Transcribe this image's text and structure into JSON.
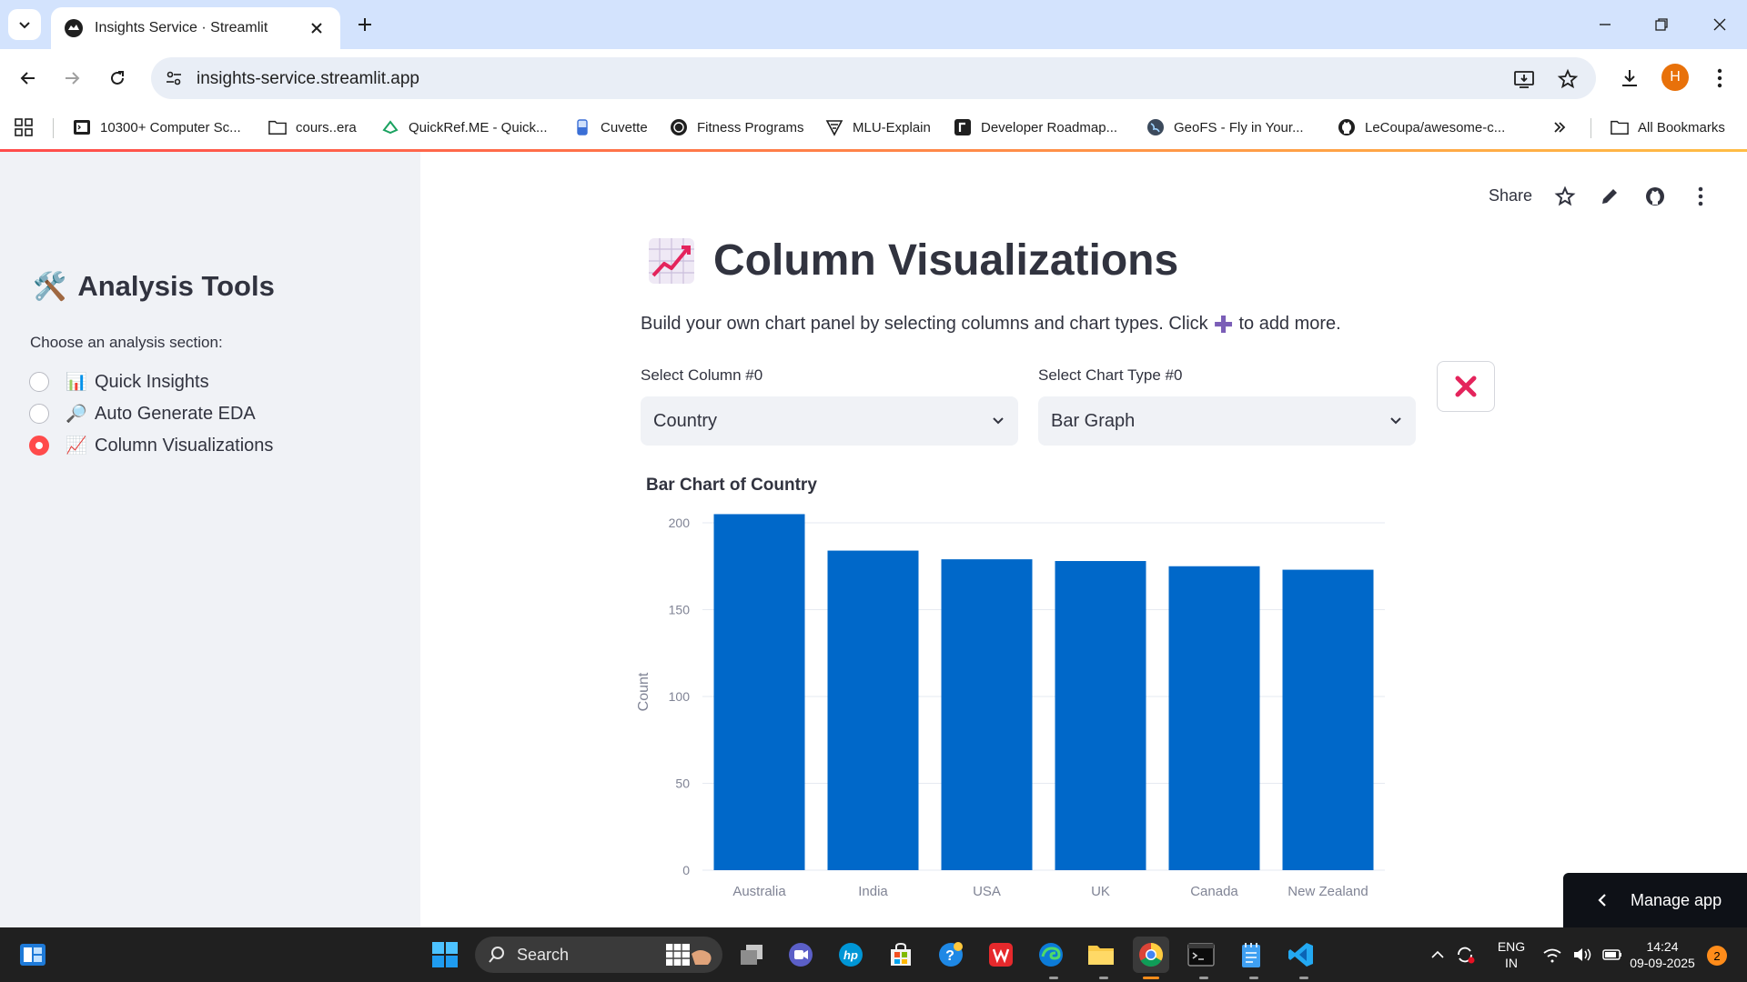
{
  "browser": {
    "tab_title": "Insights Service · Streamlit",
    "url": "insights-service.streamlit.app",
    "profile_initial": "H",
    "bookmarks": [
      "10300+ Computer Sc...",
      "cours..era",
      "QuickRef.ME - Quick...",
      "Cuvette",
      "Fitness Programs",
      "MLU-Explain",
      "Developer Roadmap...",
      "GeoFS - Fly in Your...",
      "LeCoupa/awesome-c..."
    ],
    "all_bookmarks": "All Bookmarks"
  },
  "sidebar": {
    "title_emoji": "🛠️",
    "title": "Analysis Tools",
    "radio_label": "Choose an analysis section:",
    "options": [
      {
        "emoji": "📊",
        "label": "Quick Insights",
        "selected": false
      },
      {
        "emoji": "🔎",
        "label": "Auto Generate EDA",
        "selected": false
      },
      {
        "emoji": "📈",
        "label": "Column Visualizations",
        "selected": true
      }
    ]
  },
  "header": {
    "share": "Share"
  },
  "main": {
    "title": "Column Visualizations",
    "description_before": "Build your own chart panel by selecting columns and chart types. Click",
    "description_plus": "✚",
    "description_after": "to add more.",
    "column_label": "Select Column #0",
    "column_value": "Country",
    "chart_type_label": "Select Chart Type #0",
    "chart_type_value": "Bar Graph",
    "chart_title": "Bar Chart of Country",
    "manage_app": "Manage app"
  },
  "chart_data": {
    "type": "bar",
    "title": "Bar Chart of Country",
    "categories": [
      "Australia",
      "India",
      "USA",
      "UK",
      "Canada",
      "New Zealand"
    ],
    "values": [
      205,
      184,
      179,
      178,
      175,
      173
    ],
    "xlabel": "",
    "ylabel": "Count",
    "ylim": [
      0,
      200
    ],
    "yticks": [
      0,
      50,
      100,
      150,
      200
    ],
    "bar_color": "#0068c9",
    "grid": true
  },
  "taskbar": {
    "search": "Search",
    "lang_line1": "ENG",
    "lang_line2": "IN",
    "time": "14:24",
    "date": "09-09-2025",
    "notifications": "2"
  },
  "colors": {
    "accent": "#ff4b4b",
    "tabstrip": "#d3e3fd",
    "sidebar_bg": "#f0f2f6"
  }
}
